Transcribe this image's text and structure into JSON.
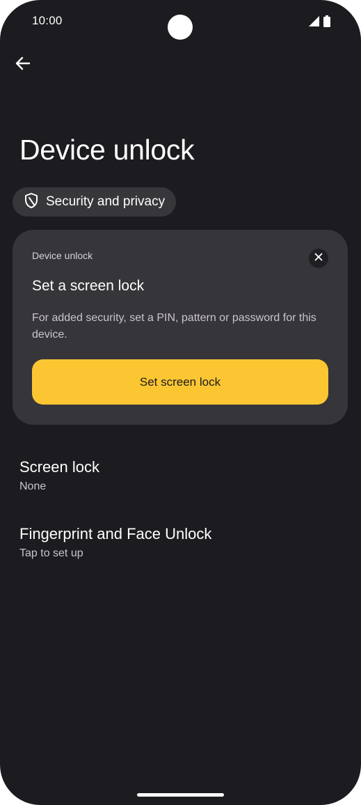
{
  "status_bar": {
    "time": "10:00",
    "icons": [
      "signal-icon",
      "battery-icon"
    ]
  },
  "header": {
    "back_icon": "back-arrow-icon",
    "title": "Device unlock"
  },
  "breadcrumb_chip": {
    "icon": "shield-icon",
    "label": "Security and privacy"
  },
  "suggestion_card": {
    "overline": "Device unlock",
    "title": "Set a screen lock",
    "body": "For added security, set a PIN, pattern or password for this device.",
    "button_label": "Set screen lock",
    "close_icon": "close-icon",
    "button_color": "#fbc632"
  },
  "settings": [
    {
      "title": "Screen lock",
      "summary": "None"
    },
    {
      "title": "Fingerprint and Face Unlock",
      "summary": "Tap to set up"
    }
  ],
  "colors": {
    "background": "#1c1b20",
    "card": "#36353a",
    "chip": "#37363b",
    "accent": "#fbc632"
  }
}
